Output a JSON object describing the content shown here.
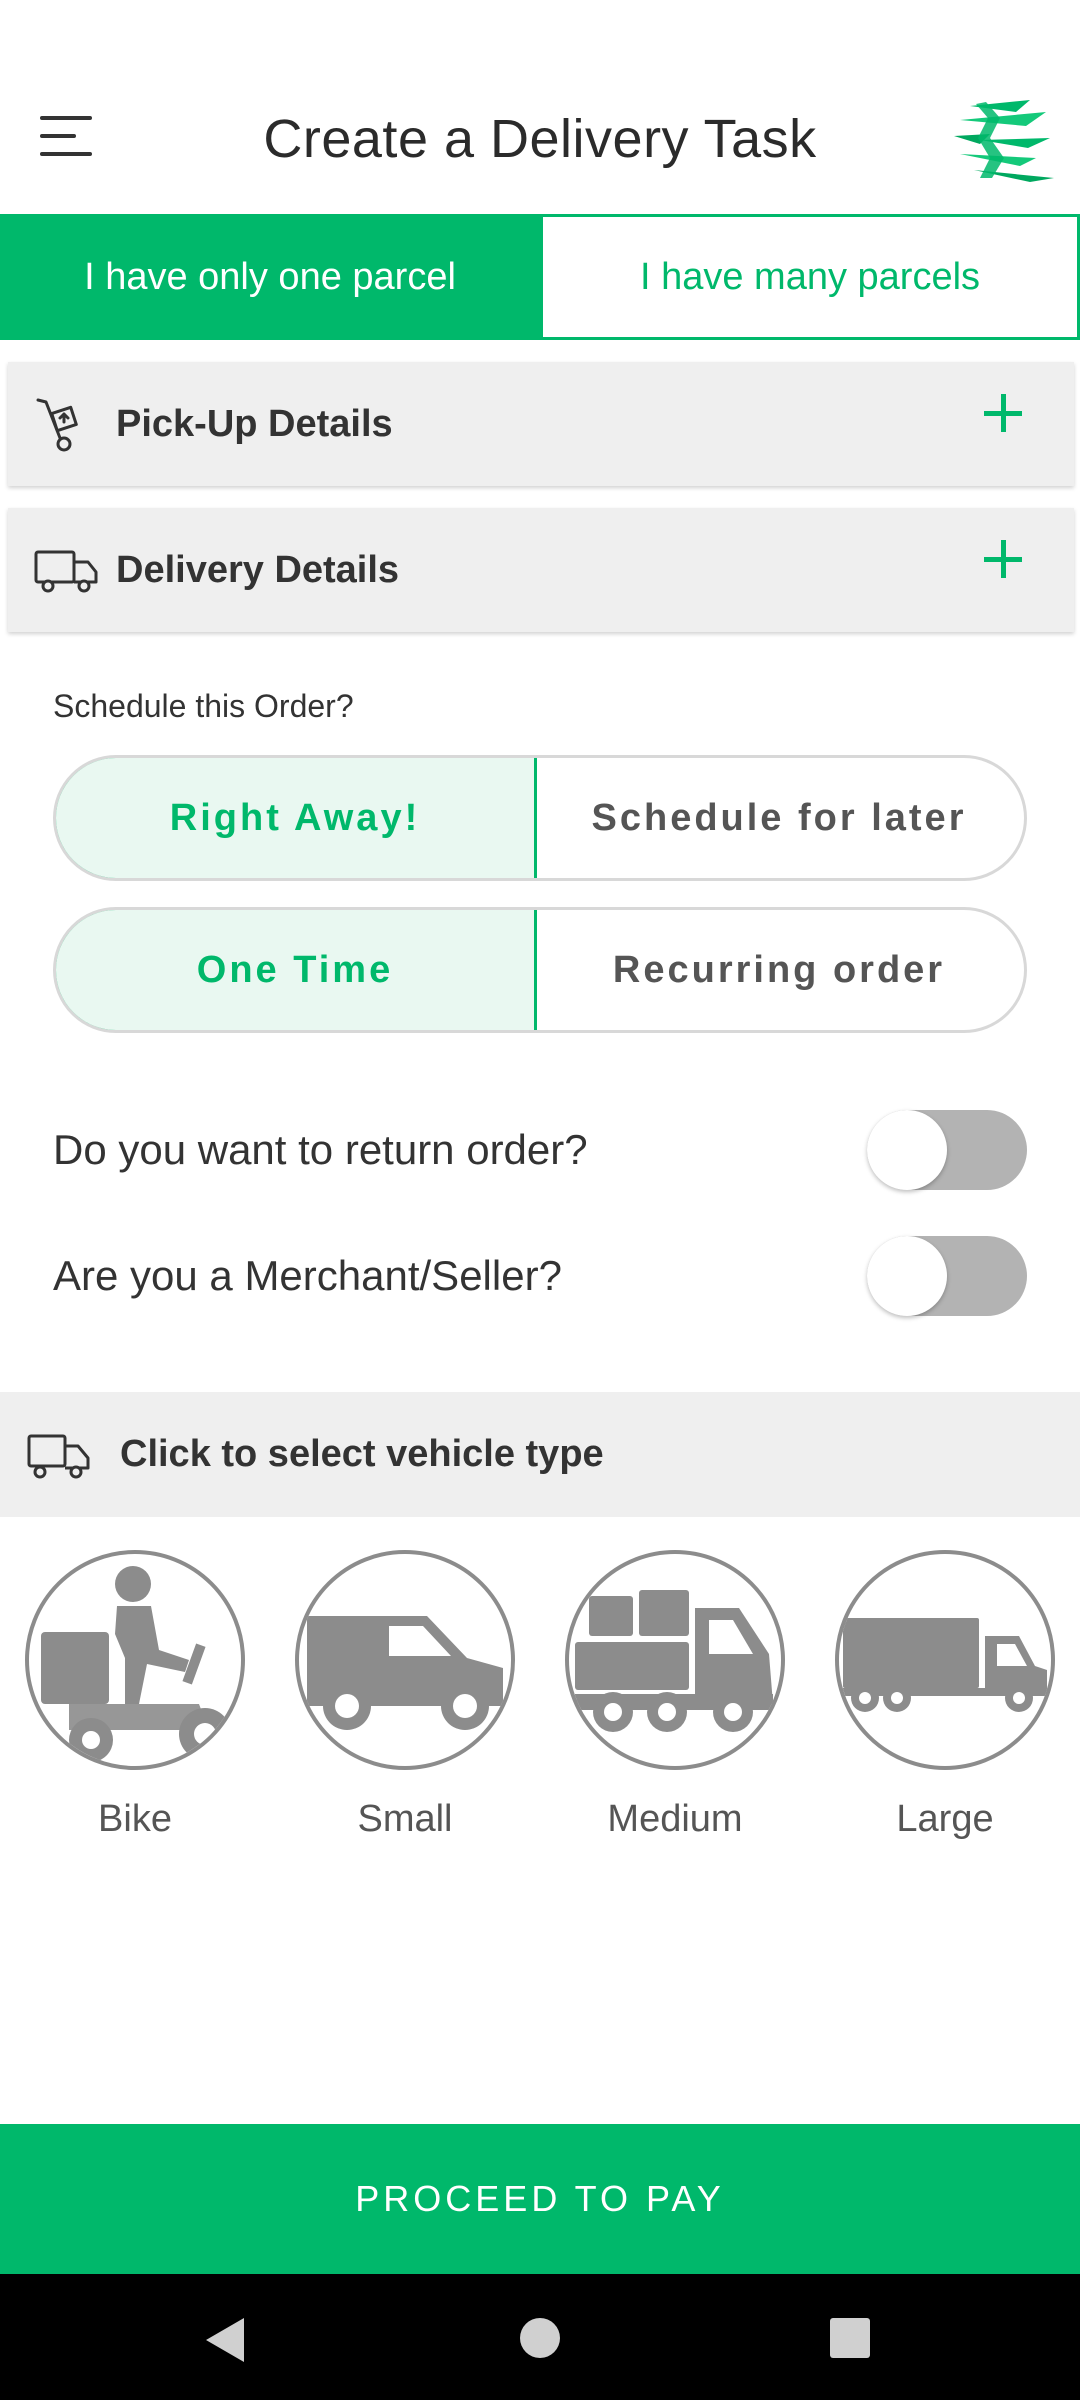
{
  "app": {
    "title": "Create a Delivery Task"
  },
  "tabs": [
    {
      "label": "I have only one parcel",
      "active": true
    },
    {
      "label": "I have many parcels",
      "active": false
    }
  ],
  "sections": {
    "pickup": {
      "label": "Pick-Up Details"
    },
    "delivery": {
      "label": "Delivery Details"
    }
  },
  "schedule": {
    "label": "Schedule this Order?",
    "timing": {
      "options": [
        "Right Away!",
        "Schedule for later"
      ],
      "selected": "Right Away!"
    },
    "frequency": {
      "options": [
        "One Time",
        "Recurring order"
      ],
      "selected": "One Time"
    }
  },
  "toggles": [
    {
      "label": "Do you want to return order?",
      "on": false
    },
    {
      "label": "Are you a Merchant/Seller?",
      "on": false
    }
  ],
  "vehicle_select": {
    "label": "Click to select vehicle type",
    "vehicles": [
      {
        "label": "Bike",
        "icon": "bike-courier-icon"
      },
      {
        "label": "Small",
        "icon": "van-icon"
      },
      {
        "label": "Medium",
        "icon": "box-truck-icon"
      },
      {
        "label": "Large",
        "icon": "semi-truck-icon"
      }
    ]
  },
  "footer": {
    "proceed_label": "PROCEED TO PAY"
  },
  "colors": {
    "accent": "#00b86b",
    "accent_light": "#e9f8f1",
    "card_bg": "#efefef",
    "icon_gray": "#8c8c8c"
  }
}
